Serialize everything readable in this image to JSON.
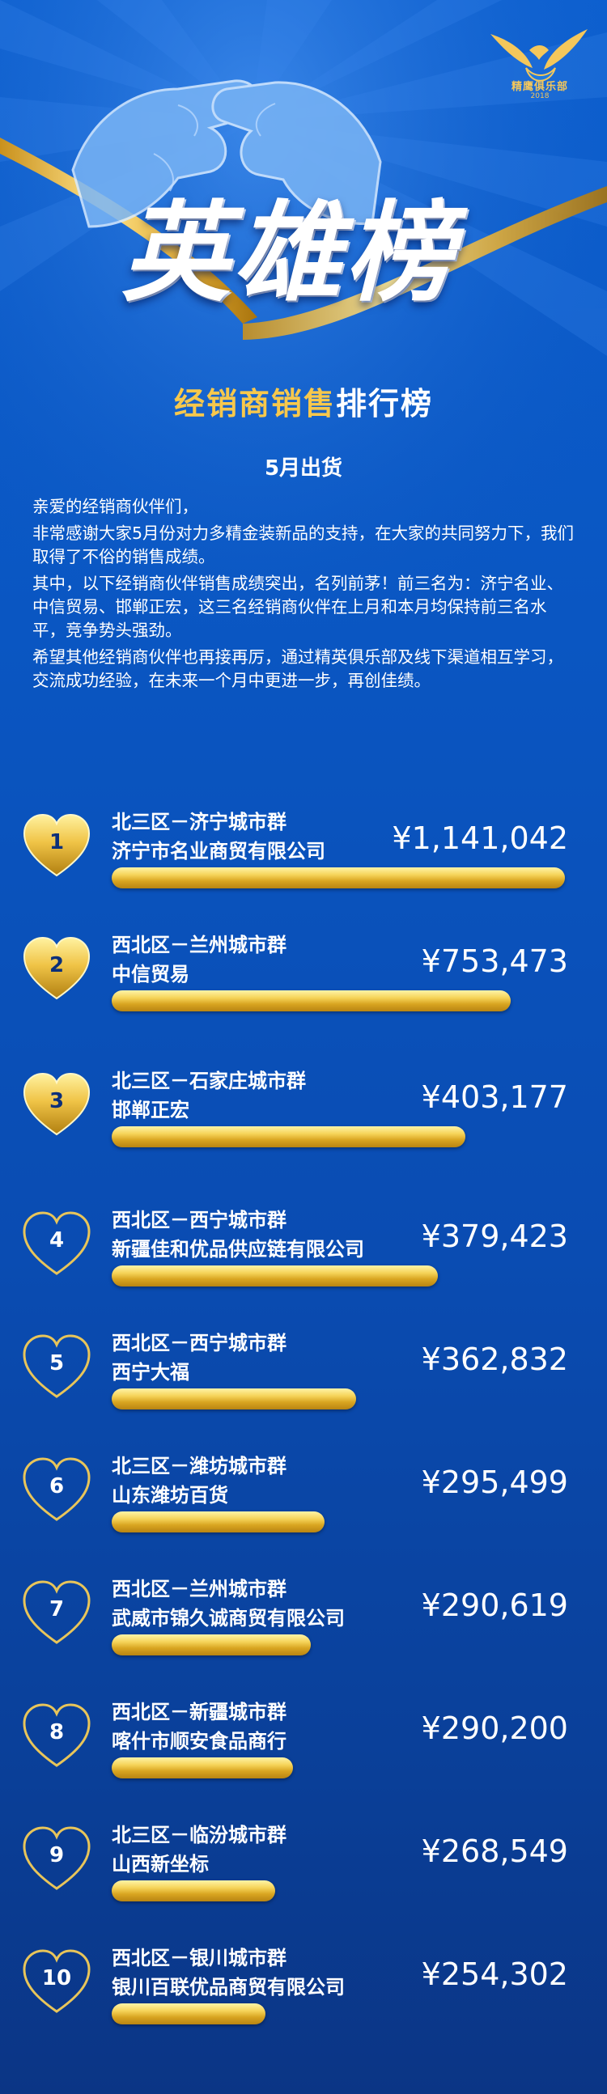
{
  "header": {
    "hero_title": "英雄榜",
    "subtitle_gold": "经销商销售",
    "subtitle_white": "排行榜",
    "month": "5月出货",
    "logo_text": "精鹰俱乐部",
    "logo_sub": "2018"
  },
  "intro": {
    "p1": "亲爱的经销商伙伴们，",
    "p2": "非常感谢大家5月份对力多精金装新品的支持，在大家的共同努力下，我们取得了不俗的销售成绩。",
    "p3": "其中，以下经销商伙伴销售成绩突出，名列前茅！前三名为：济宁名业、中信贸易、邯郸正宏，这三名经销商伙伴在上月和本月均保持前三名水平，竞争势头强劲。",
    "p4": "希望其他经销商伙伴也再接再厉，通过精英俱乐部及线下渠道相互学习，交流成功经验，在未来一个月中更进一步，再创佳绩。"
  },
  "chart_data": {
    "type": "bar",
    "title": "",
    "xlabel": "",
    "ylabel": "",
    "categories": [
      "济宁市名业商贸有限公司",
      "中信贸易",
      "邯郸正宏",
      "新疆佳和优品供应链有限公司",
      "西宁大福",
      "山东潍坊百货",
      "武威市锦久诚商贸有限公司",
      "喀什市顺安食品商行",
      "山西新坐标",
      "银川百联优品商贸有限公司"
    ],
    "values": [
      1141042,
      753473,
      403177,
      379423,
      362832,
      295499,
      290619,
      290200,
      268549,
      254302
    ],
    "rows": [
      {
        "rank": "1",
        "region": "北三区－济宁城市群",
        "company": "济宁市名业商贸有限公司",
        "amount": "¥1,141,042",
        "value": 1141042,
        "bar_fraction": 1.0,
        "medal": true
      },
      {
        "rank": "2",
        "region": "西北区－兰州城市群",
        "company": "中信贸易",
        "amount": "¥753,473",
        "value": 753473,
        "bar_fraction": 0.88,
        "medal": true
      },
      {
        "rank": "3",
        "region": "北三区－石家庄城市群",
        "company": "邯郸正宏",
        "amount": "¥403,177",
        "value": 403177,
        "bar_fraction": 0.78,
        "medal": true
      },
      {
        "rank": "4",
        "region": "西北区－西宁城市群",
        "company": "新疆佳和优品供应链有限公司",
        "amount": "¥379,423",
        "value": 379423,
        "bar_fraction": 0.72,
        "medal": false
      },
      {
        "rank": "5",
        "region": "西北区－西宁城市群",
        "company": "西宁大福",
        "amount": "¥362,832",
        "value": 362832,
        "bar_fraction": 0.54,
        "medal": false
      },
      {
        "rank": "6",
        "region": "北三区－潍坊城市群",
        "company": "山东潍坊百货",
        "amount": "¥295,499",
        "value": 295499,
        "bar_fraction": 0.47,
        "medal": false
      },
      {
        "rank": "7",
        "region": "西北区－兰州城市群",
        "company": "武威市锦久诚商贸有限公司",
        "amount": "¥290,619",
        "value": 290619,
        "bar_fraction": 0.44,
        "medal": false
      },
      {
        "rank": "8",
        "region": "西北区－新疆城市群",
        "company": "喀什市顺安食品商行",
        "amount": "¥290,200",
        "value": 290200,
        "bar_fraction": 0.4,
        "medal": false
      },
      {
        "rank": "9",
        "region": "北三区－临汾城市群",
        "company": "山西新坐标",
        "amount": "¥268,549",
        "value": 268549,
        "bar_fraction": 0.36,
        "medal": false
      },
      {
        "rank": "10",
        "region": "西北区－银川城市群",
        "company": "银川百联优品商贸有限公司",
        "amount": "¥254,302",
        "value": 254302,
        "bar_fraction": 0.34,
        "medal": false
      }
    ]
  },
  "colors": {
    "gold": "#f7c84c",
    "background_top": "#0c5fcf",
    "background_bottom": "#0b3585",
    "rank_text_dark": "#0b2f7a"
  }
}
